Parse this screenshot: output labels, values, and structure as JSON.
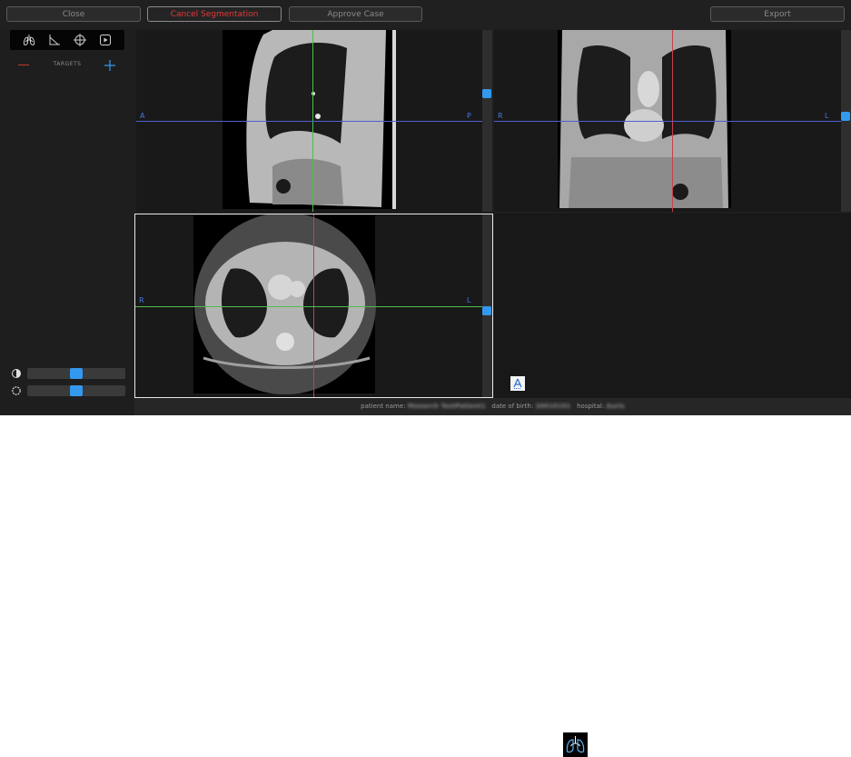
{
  "toolbar": {
    "close_label": "Close",
    "cancel_label": "Cancel Segmentation",
    "approve_label": "Approve Case",
    "export_label": "Export"
  },
  "tools": [
    "lungs-icon",
    "measure-icon",
    "crosshair-icon",
    "play-icon"
  ],
  "targets": {
    "label": "TARGETS"
  },
  "sliders": {
    "contrast": {
      "icon": "contrast-icon",
      "value": 0.5
    },
    "brightness": {
      "icon": "brightness-icon",
      "value": 0.5
    }
  },
  "views": {
    "sagittal": {
      "left_label": "A",
      "right_label": "P"
    },
    "coronal": {
      "left_label": "R",
      "right_label": "L"
    },
    "axial": {
      "left_label": "R",
      "right_label": "L"
    }
  },
  "status": {
    "patient_label": "patient name:",
    "patient_value": "Monarch TestPatient1",
    "dob_label": "date of birth:",
    "dob_value": "20010101",
    "hospital_label": "hospital:",
    "hospital_value": "Auris"
  },
  "colors": {
    "accent": "#3399ee",
    "danger": "#e23a3a",
    "axis_label": "#4a78e0",
    "crosshair_green": "#4cbf4c",
    "crosshair_red": "#c8404a",
    "crosshair_blue": "#5060d0"
  }
}
